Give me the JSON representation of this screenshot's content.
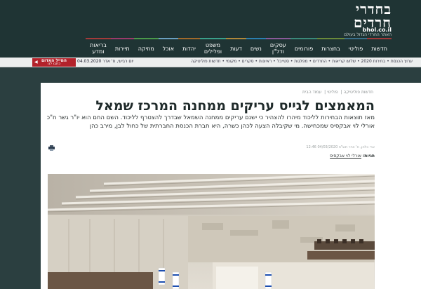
{
  "site": {
    "logo_line1": "בחדרי",
    "logo_line2": "חרדים",
    "domain": "bhol.co.il",
    "tagline": "האתר החרדי הגדול בעולם"
  },
  "nav": {
    "items": [
      {
        "label": "חדשות"
      },
      {
        "label": "פוליטי"
      },
      {
        "label": "בחצרות"
      },
      {
        "label": "פורומים"
      },
      {
        "label": "עסקים\nודל\"ן"
      },
      {
        "label": "נשים"
      },
      {
        "label": "דעות"
      },
      {
        "label": "משפט\nופלילים"
      },
      {
        "label": "יהדות"
      },
      {
        "label": "אוכל"
      },
      {
        "label": "מוזיקה"
      },
      {
        "label": "תיירות"
      },
      {
        "label": "בריאות\nומדע"
      }
    ]
  },
  "ticker": {
    "links": "ערוץ הכנסת • בחירות 2020 • שלוש קריאות • החרדים • מפלגות • סטייבל • ראיונות • סקרים • מקומי • חדשות פוליטיקה",
    "date": "יום רביעי, ח' אדר 04.03.2020",
    "live_line1": "המייל האדום",
    "live_line2": "כתבו לנו"
  },
  "article": {
    "breadcrumbs": [
      "עמוד הבית",
      "פוליטי",
      "חדשות פוליטיקה"
    ],
    "headline": "המאמצים לגייס עריקים ממחנה המרכז שמאל",
    "lead": "מאז תוצאות הבחירות לליכוד מיהרו להצהיר כי ישנם עריקים ממחנה השמאל שבדרך להצטרף לליכוד. השם החם הוא יו\"ר גשר ח\"כ אורלי לוי אבקסיס שמכחישה. מי שקיבלה הצעה לכהן כשרה, היא חברת הכנסת החברתית של כחול לבן, מירב כהן",
    "meta": "ארי כלהן, ח' אדר תש\"פ 04/03/2020 12:46",
    "tags_label": "תגיות:",
    "tag": "אורלי לוי אבקסיס"
  }
}
